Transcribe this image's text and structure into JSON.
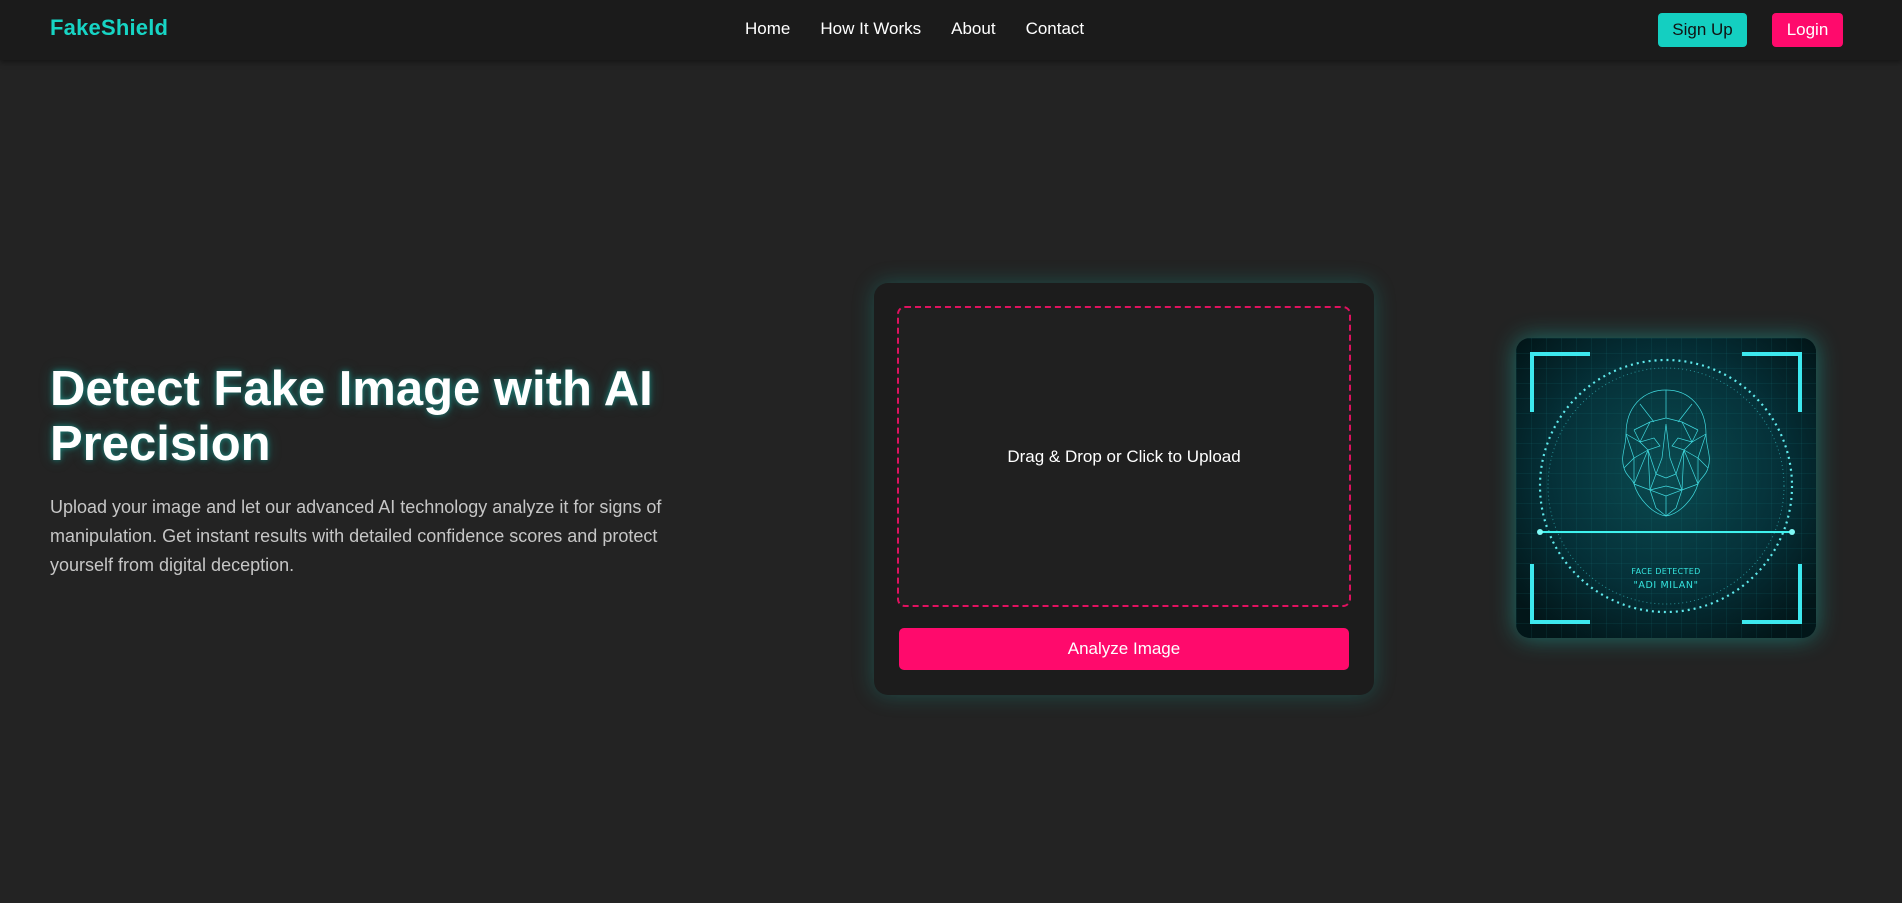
{
  "nav": {
    "logo": "FakeShield",
    "links": [
      "Home",
      "How It Works",
      "About",
      "Contact"
    ],
    "signup_label": "Sign Up",
    "login_label": "Login"
  },
  "hero": {
    "title": "Detect Fake Image with AI Precision",
    "description": "Upload your image and let our advanced AI technology analyze it for signs of manipulation. Get instant results with detailed confidence scores and protect yourself from digital deception."
  },
  "upload": {
    "dropzone_text": "Drag & Drop or Click to Upload",
    "analyze_label": "Analyze Image"
  },
  "illustration": {
    "caption_line1": "FACE DETECTED",
    "caption_line2": "\"ADI MILAN\""
  },
  "colors": {
    "background": "#232323",
    "navbar": "#1b1b1b",
    "accent_teal": "#14cfc1",
    "accent_pink": "#ff0a6c"
  }
}
